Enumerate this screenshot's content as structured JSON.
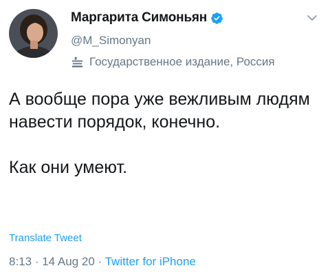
{
  "author": {
    "display_name": "Маргарита Симоньян",
    "handle": "@M_Simonyan",
    "label": "Государственное издание, Россия",
    "verified": true
  },
  "tweet": {
    "paragraph_1": "А вообще пора уже вежливым людям навести порядок, конечно.",
    "paragraph_2": "Как они умеют."
  },
  "actions": {
    "translate_label": "Translate Tweet"
  },
  "meta": {
    "time": "8:13",
    "separator_1": " · ",
    "date": "14 Aug 20",
    "separator_2": " · ",
    "source": "Twitter for iPhone"
  },
  "colors": {
    "link": "#1da1f2",
    "secondary_text": "#657786",
    "primary_text": "#14171a"
  },
  "icons": {
    "verified": "verified-badge-icon",
    "label": "government-building-icon",
    "caret": "chevron-down-icon"
  }
}
